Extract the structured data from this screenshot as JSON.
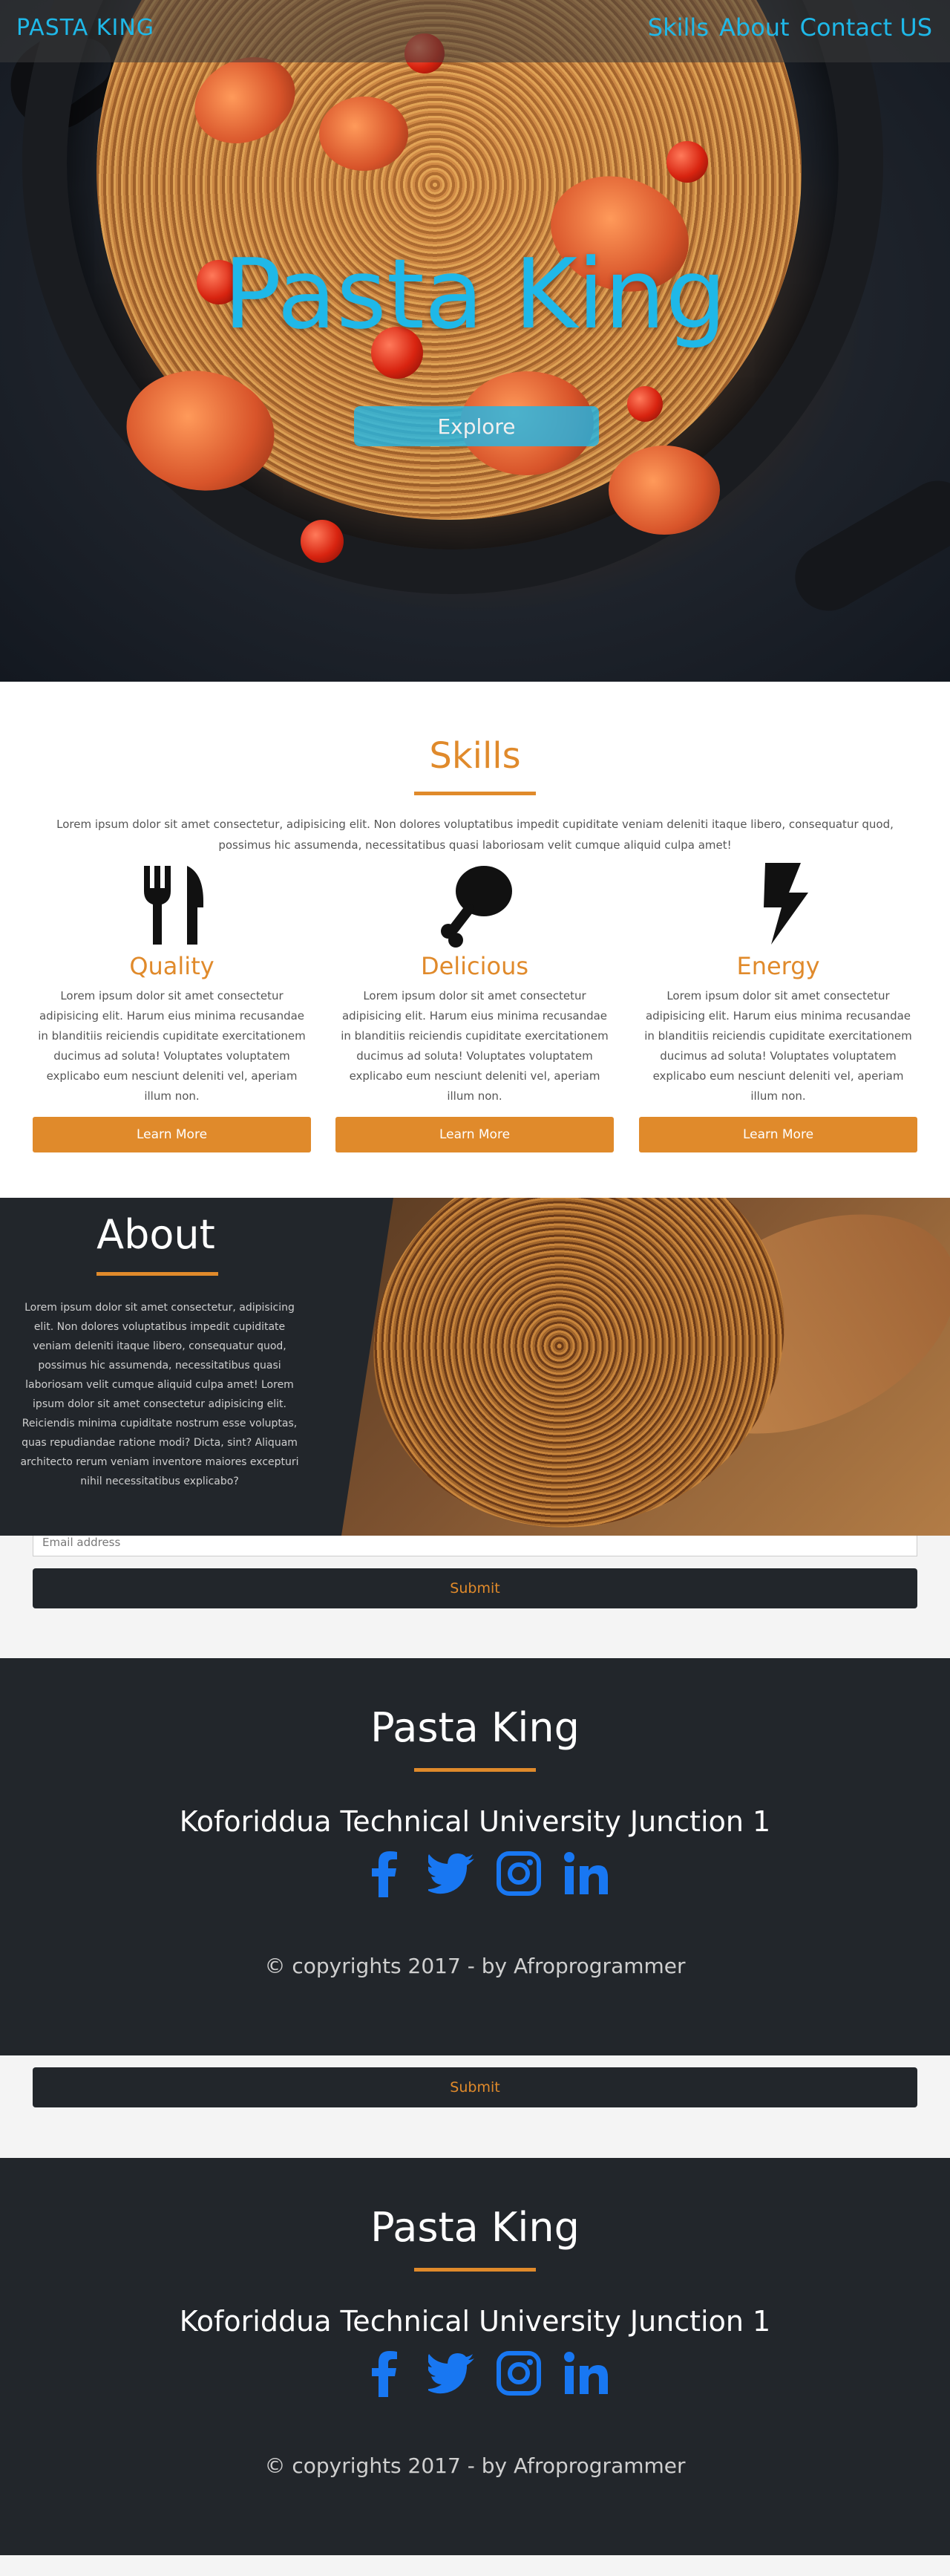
{
  "nav": {
    "brand": "PASTA KING",
    "links": [
      "Skills",
      "About",
      "Contact US"
    ]
  },
  "hero": {
    "title": "Pasta King",
    "button": "Explore"
  },
  "skills": {
    "title": "Skills",
    "intro": "Lorem ipsum dolor sit amet consectetur, adipisicing elit. Non dolores voluptatibus impedit cupiditate veniam deleniti itaque libero, consequatur quod, possimus hic assumenda, necessitatibus quasi laboriosam velit cumque aliquid culpa amet!",
    "items": [
      {
        "title": "Quality",
        "icon": "fork-knife-icon",
        "text": "Lorem ipsum dolor sit amet consectetur adipisicing elit. Harum eius minima recusandae in blanditiis reiciendis cupiditate exercitationem ducimus ad soluta! Voluptates voluptatem explicabo eum nesciunt deleniti vel, aperiam illum non.",
        "button": "Learn More"
      },
      {
        "title": "Delicious",
        "icon": "drumstick-icon",
        "text": "Lorem ipsum dolor sit amet consectetur adipisicing elit. Harum eius minima recusandae in blanditiis reiciendis cupiditate exercitationem ducimus ad soluta! Voluptates voluptatem explicabo eum nesciunt deleniti vel, aperiam illum non.",
        "button": "Learn More"
      },
      {
        "title": "Energy",
        "icon": "lightning-bolt-icon",
        "text": "Lorem ipsum dolor sit amet consectetur adipisicing elit. Harum eius minima recusandae in blanditiis reiciendis cupiditate exercitationem ducimus ad soluta! Voluptates voluptatem explicabo eum nesciunt deleniti vel, aperiam illum non.",
        "button": "Learn More"
      }
    ]
  },
  "about": {
    "title": "About",
    "text": "Lorem ipsum dolor sit amet consectetur, adipisicing elit. Non dolores voluptatibus impedit cupiditate veniam deleniti itaque libero, consequatur quod, possimus hic assumenda, necessitatibus quasi laboriosam velit cumque aliquid culpa amet! Lorem ipsum dolor sit amet consectetur adipisicing elit. Reiciendis minima cupiditate nostrum esse voluptas, quas repudiandae ratione modi? Dicta, sint? Aliquam architecto rerum veniam inventore maiores excepturi nihil necessitatibus explicabo?"
  },
  "subscribe": {
    "email_placeholder": "Email address",
    "submit": "Submit"
  },
  "footer": {
    "title": "Pasta King",
    "address": "Koforiddua Technical University Junction 1",
    "social": [
      "facebook-icon",
      "twitter-icon",
      "instagram-icon",
      "linkedin-icon"
    ],
    "copyright": "© copyrights 2017 - by Afroprogrammer"
  },
  "colors": {
    "accent": "#e08a2b",
    "brand_blue": "#1fb8e8",
    "dark": "#22262b",
    "social_blue": "#1877f2"
  }
}
